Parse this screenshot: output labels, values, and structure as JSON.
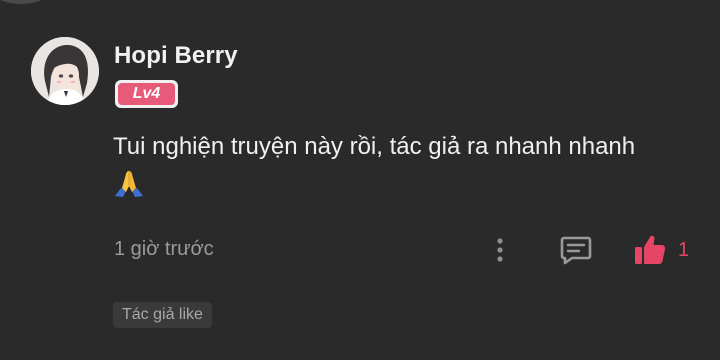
{
  "comment": {
    "username": "Hopi Berry",
    "level": "Lv4",
    "text": "Tui nghiện truyện này rồi, tác giả ra nhanh nhanh",
    "emoji": "folded-hands",
    "timestamp": "1 giờ trước",
    "like_count": "1",
    "author_like_label": "Tác giả like"
  },
  "colors": {
    "background": "#2a2a2a",
    "level_badge": "#e85a7a",
    "like_accent": "#e64565",
    "muted_text": "#9a9a9a"
  },
  "icons": {
    "more": "more-vertical-icon",
    "comment": "comment-icon",
    "like": "thumbs-up-icon"
  }
}
